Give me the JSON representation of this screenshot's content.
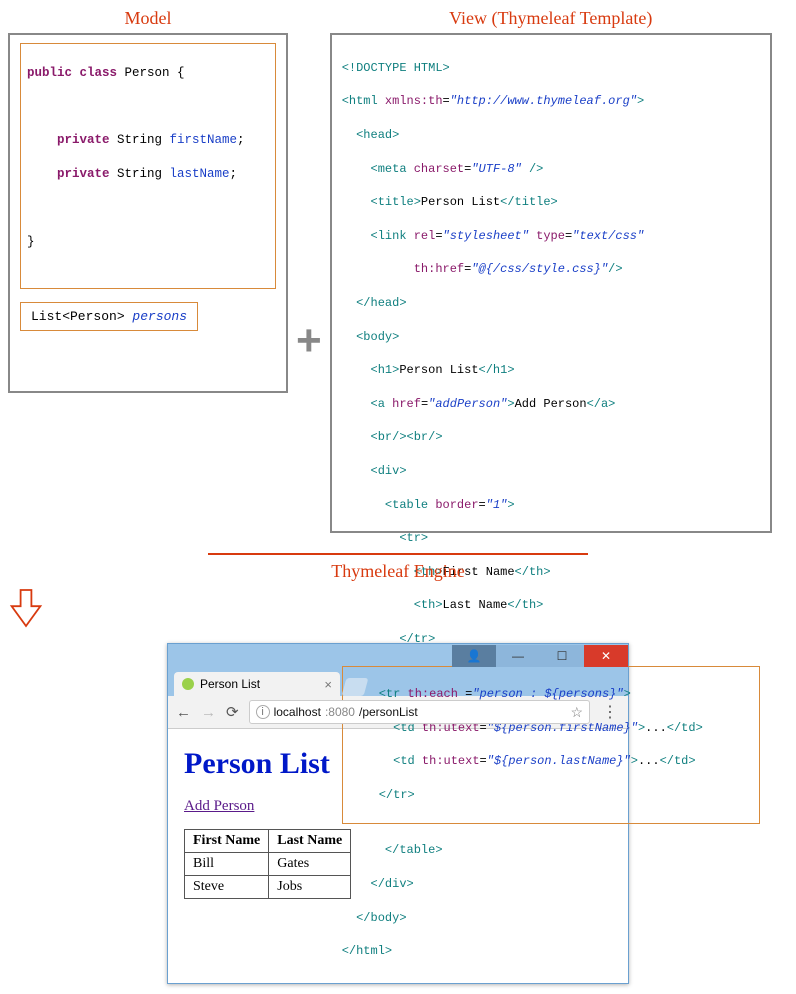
{
  "labels": {
    "model": "Model",
    "view": "View (Thymeleaf Template)",
    "engine": "Thymeleaf Engine"
  },
  "model_code": {
    "l1a": "public",
    "l1b": " class",
    "l1c": " Person {",
    "l3a": "    private",
    "l3b": " String ",
    "l3c": "firstName",
    "l3d": ";",
    "l4a": "    private",
    "l4b": " String ",
    "l4c": "lastName",
    "l4d": ";",
    "l6": "}"
  },
  "list_expr": {
    "a": "List<Person> ",
    "b": "persons"
  },
  "view_code": {
    "l1": "<!DOCTYPE HTML>",
    "l2a": "<html ",
    "l2b": "xmlns:th",
    "l2c": "=",
    "l2d": "\"http://www.thymeleaf.org\"",
    "l2e": ">",
    "l3": "  <head>",
    "l4a": "    <meta ",
    "l4b": "charset",
    "l4c": "=",
    "l4d": "\"UTF-8\"",
    "l4e": " />",
    "l5a": "    <title>",
    "l5b": "Person List",
    "l5c": "</title>",
    "l6a": "    <link ",
    "l6b": "rel",
    "l6c": "=",
    "l6d": "\"stylesheet\"",
    "l6e": " type",
    "l6f": "=",
    "l6g": "\"text/css\"",
    "l7a": "          th:href",
    "l7b": "=",
    "l7c": "\"@{/css/style.css}\"",
    "l7d": "/>",
    "l8": "  </head>",
    "l9": "  <body>",
    "l10a": "    <h1>",
    "l10b": "Person List",
    "l10c": "</h1>",
    "l11a": "    <a ",
    "l11b": "href",
    "l11c": "=",
    "l11d": "\"addPerson\"",
    "l11e": ">",
    "l11f": "Add Person",
    "l11g": "</a>",
    "l12": "    <br/><br/>",
    "l13": "    <div>",
    "l14a": "      <table ",
    "l14b": "border",
    "l14c": "=",
    "l14d": "\"1\"",
    "l14e": ">",
    "l15": "        <tr>",
    "l16a": "          <th>",
    "l16b": "First Name",
    "l16c": "</th>",
    "l17a": "          <th>",
    "l17b": "Last Name",
    "l17c": "</th>",
    "l18": "        </tr>",
    "h1a": "     <tr ",
    "h1b": "th:each ",
    "h1c": "=",
    "h1d": "\"person : ${persons}\"",
    "h1e": ">",
    "h2a": "       <td ",
    "h2b": "th:utext",
    "h2c": "=",
    "h2d": "\"${person.firstName}\"",
    "h2e": ">",
    "h2f": "...",
    "h2g": "</td>",
    "h3a": "       <td ",
    "h3b": "th:utext",
    "h3c": "=",
    "h3d": "\"${person.lastName}\"",
    "h3e": ">",
    "h3f": "...",
    "h3g": "</td>",
    "h4": "     </tr>",
    "l19": "      </table>",
    "l20": "    </div>",
    "l21": "  </body>",
    "l22": "</html>"
  },
  "browser": {
    "tab_title": "Person List",
    "url_host": "localhost",
    "url_port": ":8080",
    "url_path": "/personList",
    "page_title": "Person List",
    "add_link": "Add Person",
    "th1": "First Name",
    "th2": "Last Name",
    "rows": [
      {
        "fn": "Bill",
        "ln": "Gates"
      },
      {
        "fn": "Steve",
        "ln": "Jobs"
      }
    ]
  }
}
